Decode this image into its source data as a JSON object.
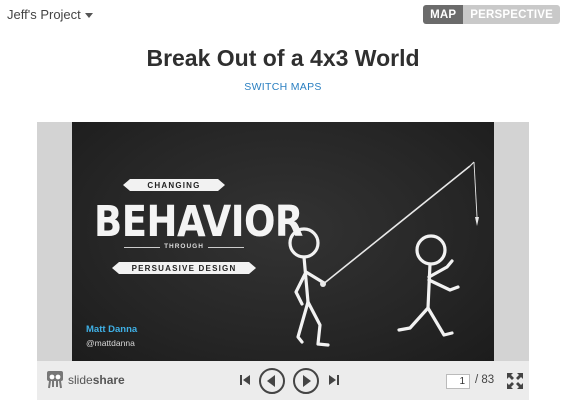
{
  "header": {
    "project_label": "Jeff's Project",
    "view_toggle": {
      "map_label": "MAP",
      "perspective_label": "PERSPECTIVE",
      "active": "MAP"
    }
  },
  "page": {
    "title": "Break Out of a 4x3 World",
    "switch_label": "SWITCH MAPS"
  },
  "slide": {
    "ribbon_top": "CHANGING",
    "headline": "BEHAVIOR",
    "connector": "THROUGH",
    "ribbon_bottom": "PERSUASIVE DESIGN",
    "author_name": "Matt Danna",
    "author_handle": "@mattdanna"
  },
  "player": {
    "brand_light": "slide",
    "brand_bold": "share",
    "current_page": "1",
    "total_pages": "/ 83"
  },
  "colors": {
    "accent_link": "#2a7fc1",
    "author_blue": "#3fb0e6",
    "toggle_active": "#6b6b6b",
    "toggle_inactive": "#c9c9c9"
  },
  "icons": [
    "chevron-down-icon",
    "first-slide-icon",
    "previous-icon",
    "next-icon",
    "last-slide-icon",
    "fullscreen-icon",
    "slideshare-logo-icon"
  ]
}
